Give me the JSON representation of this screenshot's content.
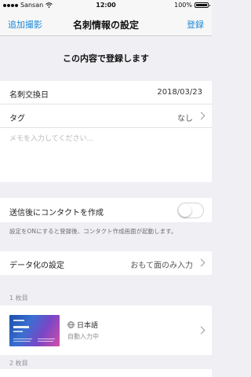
{
  "status": {
    "carrier": "Sansan",
    "time": "12:00",
    "battery": "100%"
  },
  "nav": {
    "left": "追加撮影",
    "title": "名刺情報の設定",
    "right": "登録"
  },
  "banner": "この内容で登録します",
  "details": {
    "date_label": "名刺交換日",
    "date_value": "2018/03/23",
    "tag_label": "タグ",
    "tag_value": "なし",
    "memo_placeholder": "メモを入力してください..."
  },
  "contact": {
    "label": "送信後にコンタクトを作成",
    "enabled": false,
    "note": "設定をONにすると登録後、コンタクト作成画面が起動します。"
  },
  "digitize": {
    "label": "データ化の設定",
    "value": "おもて面のみ入力"
  },
  "sections": {
    "first": "1 枚目",
    "second": "2 枚目"
  },
  "card1": {
    "language": "日本語",
    "status": "自動入力中"
  },
  "colors": {
    "accent": "#1f8ad8",
    "background": "#efeff4"
  }
}
